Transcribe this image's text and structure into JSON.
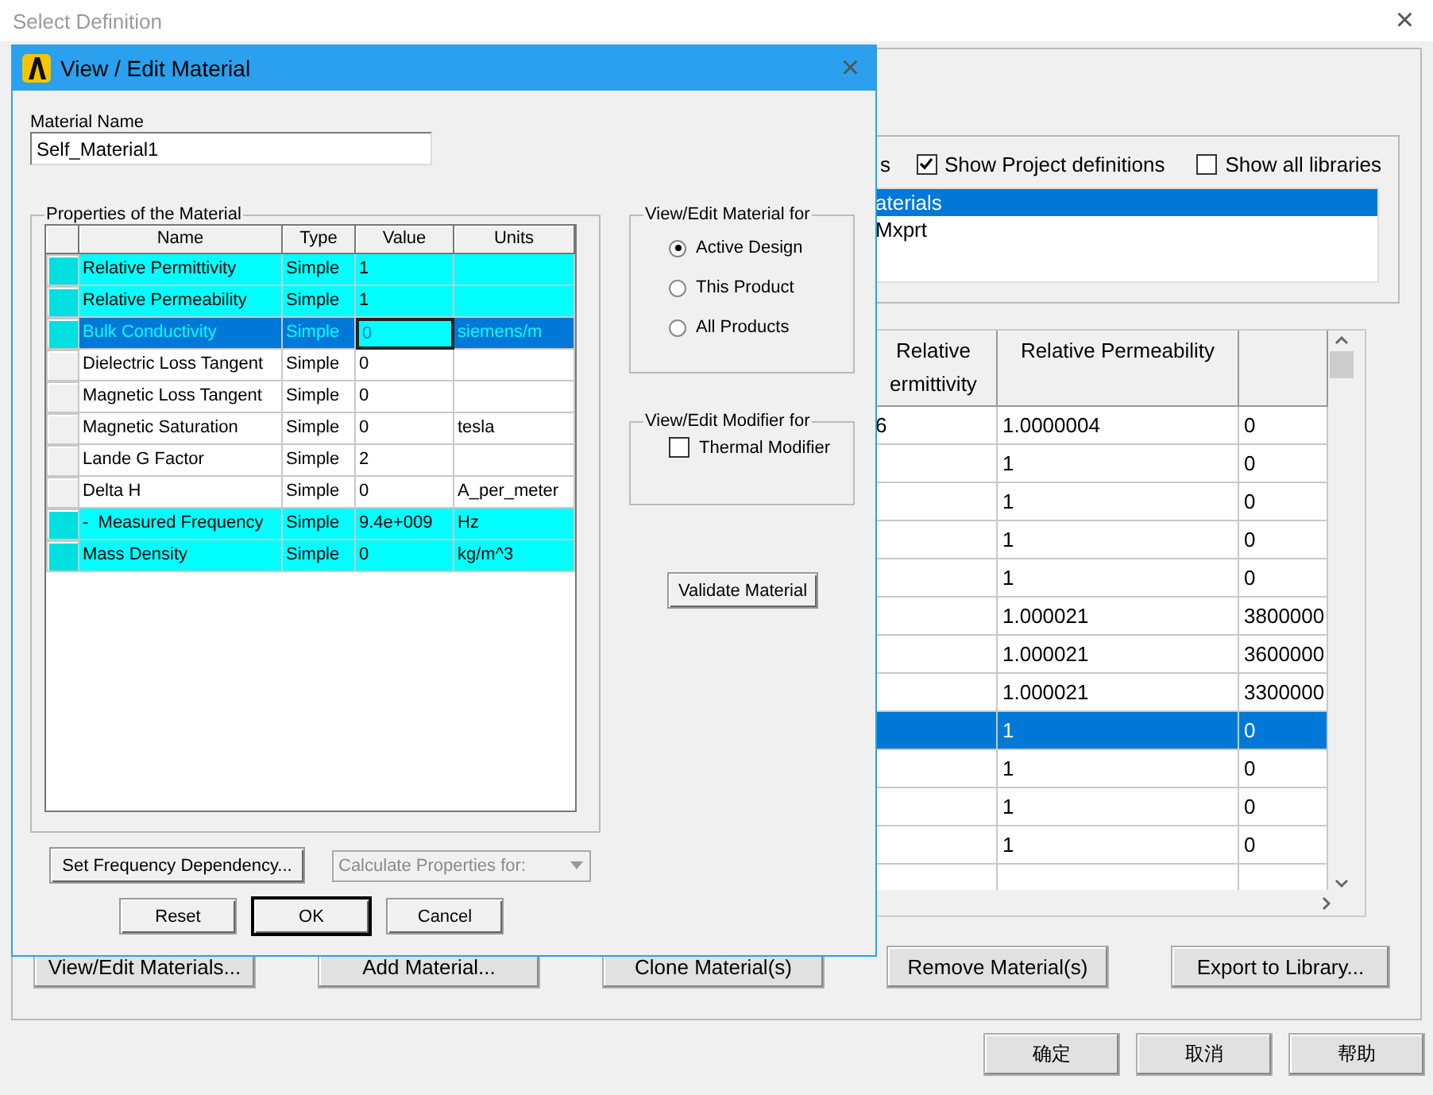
{
  "window": {
    "title": "Select Definition",
    "close": "×"
  },
  "filters": {
    "partial_label": "s",
    "checkboxes": [
      {
        "label": "Show Project definitions",
        "checked": true
      },
      {
        "label": "Show all libraries",
        "checked": false
      }
    ]
  },
  "libraries": [
    {
      "label": "aterials",
      "selected": true
    },
    {
      "label": "Mxprt",
      "selected": false
    }
  ],
  "materials_table": {
    "columns": [
      "Relative ermittivity",
      "Relative Permeability"
    ],
    "rows": [
      {
        "cells": [
          "6",
          "1.0000004",
          "0"
        ],
        "selected": false
      },
      {
        "cells": [
          "",
          "1",
          "0"
        ],
        "selected": false
      },
      {
        "cells": [
          "",
          "1",
          "0"
        ],
        "selected": false
      },
      {
        "cells": [
          "",
          "1",
          "0"
        ],
        "selected": false
      },
      {
        "cells": [
          "",
          "1",
          "0"
        ],
        "selected": false
      },
      {
        "cells": [
          "",
          "1.000021",
          "3800000"
        ],
        "selected": false
      },
      {
        "cells": [
          "",
          "1.000021",
          "3600000"
        ],
        "selected": false
      },
      {
        "cells": [
          "",
          "1.000021",
          "3300000"
        ],
        "selected": false
      },
      {
        "cells": [
          "",
          "1",
          "0"
        ],
        "selected": true
      },
      {
        "cells": [
          "",
          "1",
          "0"
        ],
        "selected": false
      },
      {
        "cells": [
          "",
          "1",
          "0"
        ],
        "selected": false
      },
      {
        "cells": [
          "",
          "1",
          "0"
        ],
        "selected": false
      },
      {
        "cells": [
          "",
          "",
          ""
        ],
        "selected": false
      }
    ]
  },
  "actions": [
    "View/Edit Materials...",
    "Add Material...",
    "Clone Material(s)",
    "Remove Material(s)",
    "Export to Library..."
  ],
  "dialog_buttons": [
    "确定",
    "取消",
    "帮助"
  ],
  "edit_dialog": {
    "title": "View / Edit Material",
    "close": "×",
    "material_name": {
      "label": "Material Name",
      "value": "Self_Material1"
    },
    "properties": {
      "title": "Properties of the Material",
      "columns": [
        "Name",
        "Type",
        "Value",
        "Units"
      ],
      "rows": [
        {
          "name": "Relative Permittivity",
          "type": "Simple",
          "value": "1",
          "units": "",
          "highlighted": true,
          "selected": false
        },
        {
          "name": "Relative Permeability",
          "type": "Simple",
          "value": "1",
          "units": "",
          "highlighted": true,
          "selected": false
        },
        {
          "name": "Bulk Conductivity",
          "type": "Simple",
          "value": "0",
          "units": "siemens/m",
          "highlighted": true,
          "selected": true
        },
        {
          "name": "Dielectric Loss Tangent",
          "type": "Simple",
          "value": "0",
          "units": "",
          "highlighted": false,
          "selected": false
        },
        {
          "name": "Magnetic Loss Tangent",
          "type": "Simple",
          "value": "0",
          "units": "",
          "highlighted": false,
          "selected": false
        },
        {
          "name": "Magnetic Saturation",
          "type": "Simple",
          "value": "0",
          "units": "tesla",
          "highlighted": false,
          "selected": false
        },
        {
          "name": "Lande G Factor",
          "type": "Simple",
          "value": "2",
          "units": "",
          "highlighted": false,
          "selected": false
        },
        {
          "name": "Delta H",
          "type": "Simple",
          "value": "0",
          "units": "A_per_meter",
          "highlighted": false,
          "selected": false
        },
        {
          "name": "-  Measured Frequency",
          "type": "Simple",
          "value": "9.4e+009",
          "units": "Hz",
          "highlighted": true,
          "selected": false
        },
        {
          "name": "Mass Density",
          "type": "Simple",
          "value": "0",
          "units": "kg/m^3",
          "highlighted": true,
          "selected": false
        }
      ]
    },
    "material_for": {
      "title": "View/Edit Material for",
      "options": [
        {
          "label": "Active Design",
          "selected": true
        },
        {
          "label": "This Product",
          "selected": false
        },
        {
          "label": "All Products",
          "selected": false
        }
      ]
    },
    "modifier_for": {
      "title": "View/Edit Modifier for",
      "checkboxes": [
        {
          "label": "Thermal Modifier",
          "checked": false
        }
      ]
    },
    "validate_button": "Validate Material",
    "frequency_button": "Set Frequency Dependency...",
    "calculate_select": {
      "placeholder": "Calculate Properties for:",
      "disabled": true
    },
    "buttons": [
      {
        "label": "Reset",
        "default": false
      },
      {
        "label": "OK",
        "default": true
      },
      {
        "label": "Cancel",
        "default": false
      }
    ]
  }
}
